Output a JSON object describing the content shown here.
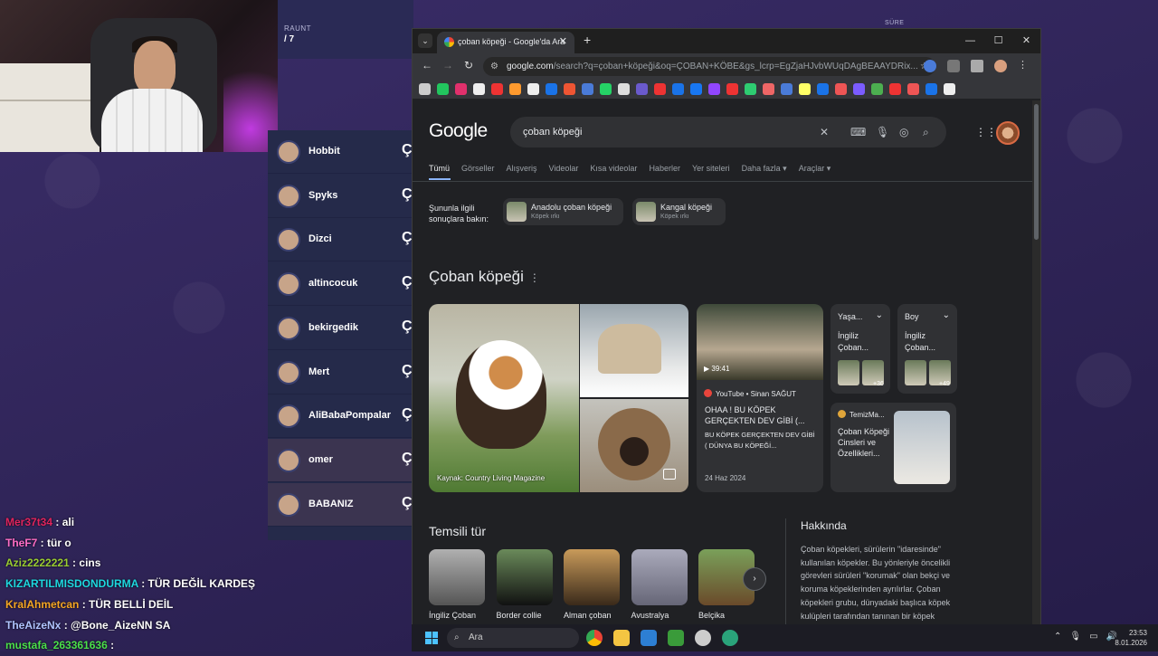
{
  "game": {
    "raunt_label": "RAUNT",
    "raunt_value": "/ 7",
    "sure_label": "SÜRE",
    "players": [
      {
        "name": "Hobbit",
        "char": "Ç"
      },
      {
        "name": "Spyks",
        "char": "Ç"
      },
      {
        "name": "Dizci",
        "char": "Ç"
      },
      {
        "name": "altincocuk",
        "char": "Ç"
      },
      {
        "name": "bekirgedik",
        "char": "Ç"
      },
      {
        "name": "Mert",
        "char": "Ç"
      },
      {
        "name": "AliBabaPompalar",
        "char": "Ç"
      },
      {
        "name": "omer",
        "char": "Ç"
      },
      {
        "name": "BABANIZ",
        "char": "Ç"
      }
    ]
  },
  "chat": [
    {
      "user": "Mer37t34",
      "color": "#e0245e",
      "msg": "ali"
    },
    {
      "user": "TheF7",
      "color": "#ff6ec7",
      "msg": "tür o"
    },
    {
      "user": "Aziz2222221",
      "color": "#9acd32",
      "msg": "cins"
    },
    {
      "user": "KIZARTILMISDONDURMA",
      "color": "#1ed8e0",
      "msg": "TÜR DEĞİL KARDEŞ"
    },
    {
      "user": "KralAhmetcan",
      "color": "#f5a623",
      "msg": "TÜR BELLİ DEİL"
    },
    {
      "user": "TheAizeNx",
      "color": "#b0c4ff",
      "msg": "@Bone_AizeNN SA"
    },
    {
      "user": "mustafa_263361636",
      "color": "#4be04b",
      "msg": ""
    }
  ],
  "browser": {
    "tab_title": "çoban köpeği - Google'da Ara",
    "url_host": "google.com",
    "url_rest": "/search?q=çoban+köpeği&oq=ÇOBAN+KÖBE&gs_lcrp=EgZjaHJvbWUqDAgBEAAYDRix...",
    "search_query": "çoban köpeği",
    "logo": "Google",
    "tabs": [
      "Tümü",
      "Görseller",
      "Alışveriş",
      "Videolar",
      "Kısa videolar",
      "Haberler",
      "Yer siteleri",
      "Daha fazla ▾",
      "Araçlar ▾"
    ],
    "related_label_1": "Şununla ilgili",
    "related_label_2": "sonuçlara bakın:",
    "chips": [
      {
        "title": "Anadolu çoban köpeği",
        "sub": "Köpek ırkı"
      },
      {
        "title": "Kangal köpeği",
        "sub": "Köpek ırkı"
      }
    ],
    "kp_title": "Çoban köpeği",
    "image_caption": "Kaynak: Country Living Magazine",
    "video": {
      "duration": "▶ 39:41",
      "source": "YouTube • Sinan SAĞUT",
      "title": "OHAA ! BU KÖPEK GERÇEKTEN DEV GİBİ (...",
      "desc": "BU KÖPEK GERÇEKTEN DEV GİBİ ( DÜNYA BU KÖPEĞİ...",
      "date": "24 Haz 2024"
    },
    "cards": [
      {
        "head": "Yaşa...",
        "body": "İngiliz Çoban...",
        "more": "+36"
      },
      {
        "head": "Boy",
        "body": "İngiliz Çoban...",
        "more": "+49"
      }
    ],
    "temiz": {
      "source": "TemizMa...",
      "text": "Çoban Köpeği Cinsleri ve Özellikleri..."
    },
    "section_title": "Temsili tür",
    "breeds": [
      "İngiliz Çoban",
      "Border collie",
      "Alman çoban",
      "Avustralya",
      "Belçika"
    ],
    "about_title": "Hakkında",
    "about_text": "Çoban köpekleri, sürülerin \"idaresinde\" kullanılan köpekler. Bu yönleriyle öncelikli görevleri sürüleri \"korumak\" olan bekçi ve koruma köpeklerinden ayrılırlar. Çoban köpekleri grubu, dünyadaki başlıca köpek kulüpleri tarafından tanınan bir köpek"
  },
  "taskbar": {
    "search_placeholder": "Ara",
    "time": "23:53",
    "date": "8.01.2026"
  }
}
